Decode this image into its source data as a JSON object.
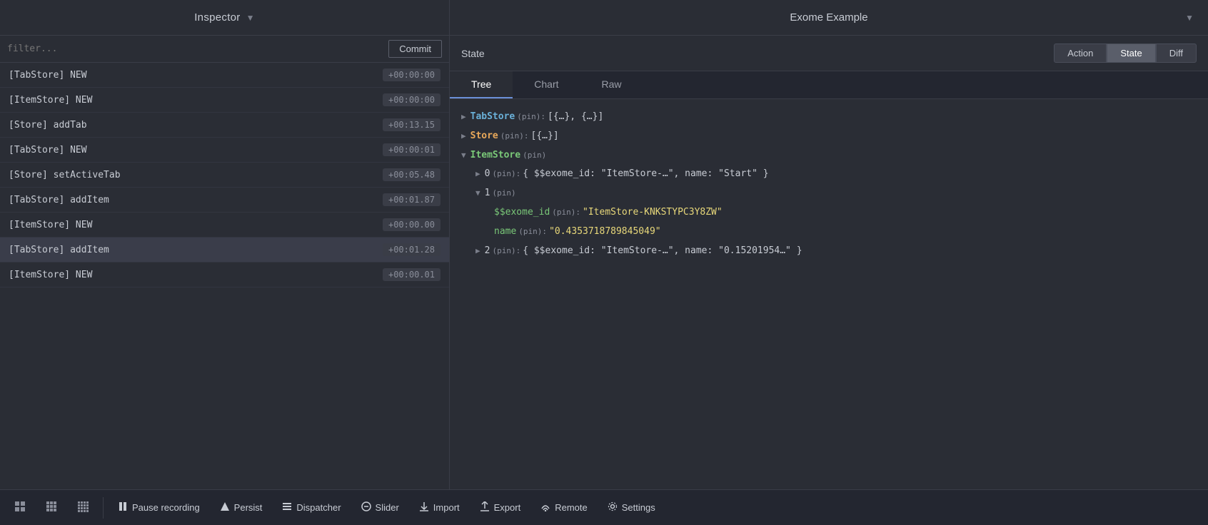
{
  "topBar": {
    "leftTitle": "Inspector",
    "leftArrow": "▼",
    "rightTitle": "Exome Example",
    "rightArrow": "▼"
  },
  "leftPanel": {
    "filterPlaceholder": "filter...",
    "commitLabel": "Commit",
    "logItems": [
      {
        "label": "[TabStore] NEW",
        "time": "+00:00:00"
      },
      {
        "label": "[ItemStore] NEW",
        "time": "+00:00:00"
      },
      {
        "label": "[Store] addTab",
        "time": "+00:13.15"
      },
      {
        "label": "[TabStore] NEW",
        "time": "+00:00:01"
      },
      {
        "label": "[Store] setActiveTab",
        "time": "+00:05.48"
      },
      {
        "label": "[TabStore] addItem",
        "time": "+00:01.87"
      },
      {
        "label": "[ItemStore] NEW",
        "time": "+00:00.00"
      },
      {
        "label": "[TabStore] addItem",
        "time": "+00:01.28"
      },
      {
        "label": "[ItemStore] NEW",
        "time": "+00:00.01"
      }
    ]
  },
  "rightPanel": {
    "headerTitle": "State",
    "tabs": [
      {
        "label": "Action",
        "active": false
      },
      {
        "label": "State",
        "active": true
      },
      {
        "label": "Diff",
        "active": false
      }
    ],
    "subtabs": [
      {
        "label": "Tree",
        "active": true
      },
      {
        "label": "Chart",
        "active": false
      },
      {
        "label": "Raw",
        "active": false
      }
    ],
    "treeLines": [
      {
        "indent": 0,
        "toggle": "▶",
        "keyClass": "tabstore",
        "key": "TabStore",
        "meta": "(pin):",
        "value": "[{…}, {…}]"
      },
      {
        "indent": 0,
        "toggle": "▶",
        "keyClass": "store",
        "key": "Store",
        "meta": "(pin):",
        "value": "[{…}]"
      },
      {
        "indent": 0,
        "toggle": "▼",
        "keyClass": "itemstore",
        "key": "ItemStore",
        "meta": "(pin)",
        "value": ""
      },
      {
        "indent": 1,
        "toggle": "▶",
        "keyClass": "number",
        "key": "0",
        "meta": "(pin):",
        "value": "{ $$exome_id: \"ItemStore-…\", name: \"Start\" }"
      },
      {
        "indent": 1,
        "toggle": "▼",
        "keyClass": "number",
        "key": "1",
        "meta": "(pin)",
        "value": ""
      },
      {
        "indent": 2,
        "toggle": "",
        "keyClass": "field",
        "key": "$$exome_id",
        "meta": "(pin):",
        "value": "\"ItemStore-KNKSTYPC3Y8ZW\""
      },
      {
        "indent": 2,
        "toggle": "",
        "keyClass": "field",
        "key": "name",
        "meta": "(pin):",
        "value": "\"0.4353718789845049\""
      },
      {
        "indent": 1,
        "toggle": "▶",
        "keyClass": "number",
        "key": "2",
        "meta": "(pin):",
        "value": "{ $$exome_id: \"ItemStore-…\", name: \"0.15201954…\" }"
      }
    ]
  },
  "bottomToolbar": {
    "buttons": [
      {
        "icon": "grid1",
        "label": "",
        "name": "grid1-button"
      },
      {
        "icon": "grid2",
        "label": "",
        "name": "grid2-button"
      },
      {
        "icon": "grid3",
        "label": "",
        "name": "grid3-button"
      },
      {
        "icon": "pause",
        "label": "Pause recording",
        "name": "pause-recording-button"
      },
      {
        "icon": "persist",
        "label": "Persist",
        "name": "persist-button"
      },
      {
        "icon": "dispatcher",
        "label": "Dispatcher",
        "name": "dispatcher-button"
      },
      {
        "icon": "slider",
        "label": "Slider",
        "name": "slider-button"
      },
      {
        "icon": "import",
        "label": "Import",
        "name": "import-button"
      },
      {
        "icon": "export",
        "label": "Export",
        "name": "export-button"
      },
      {
        "icon": "remote",
        "label": "Remote",
        "name": "remote-button"
      },
      {
        "icon": "settings",
        "label": "Settings",
        "name": "settings-button"
      }
    ]
  }
}
